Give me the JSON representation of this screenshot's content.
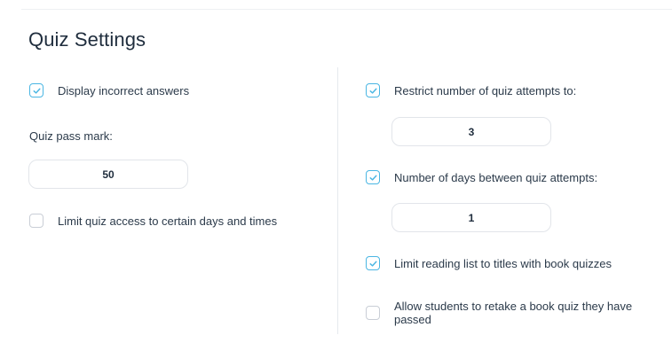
{
  "page": {
    "title": "Quiz Settings"
  },
  "left": {
    "display_incorrect": {
      "label": "Display incorrect answers",
      "checked": true
    },
    "pass_mark_label": "Quiz pass mark:",
    "pass_mark_value": "50",
    "limit_access": {
      "label": "Limit quiz access to certain days and times",
      "checked": false
    }
  },
  "right": {
    "restrict_attempts": {
      "label": "Restrict number of quiz attempts to:",
      "checked": true
    },
    "attempts_value": "3",
    "days_between": {
      "label": "Number of days between quiz attempts:",
      "checked": true
    },
    "days_value": "1",
    "limit_reading_list": {
      "label": "Limit reading list to titles with book quizzes",
      "checked": true
    },
    "allow_retake": {
      "label": "Allow students to retake a book quiz they have passed",
      "checked": false
    }
  },
  "colors": {
    "accent": "#4ab6e3",
    "checkbox_border": "#c9ced6",
    "text": "#2b3a4a"
  },
  "icons": {
    "check": "checkmark-icon"
  }
}
